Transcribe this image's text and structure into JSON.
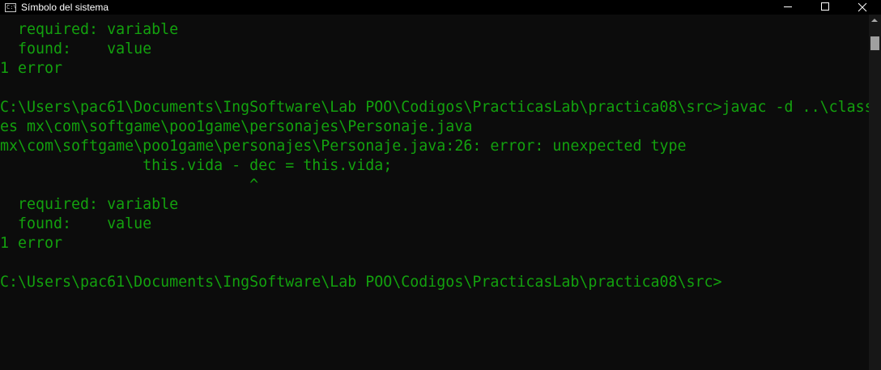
{
  "window": {
    "title": "Símbolo del sistema",
    "icon": "cmd-icon",
    "icon_text": "C:\\"
  },
  "colors": {
    "console_text": "#13a10e",
    "background": "#0c0c0c",
    "titlebar": "#000000"
  },
  "controls": [
    "minimize-icon",
    "maximize-icon",
    "close-icon"
  ],
  "console": {
    "lines": [
      "  required: variable",
      "  found:    value",
      "1 error",
      "",
      "C:\\Users\\pac61\\Documents\\IngSoftware\\Lab POO\\Codigos\\PracticasLab\\practica08\\src>javac -d ..\\class",
      "es mx\\com\\softgame\\poo1game\\personajes\\Personaje.java",
      "mx\\com\\softgame\\poo1game\\personajes\\Personaje.java:26: error: unexpected type",
      "                this.vida - dec = this.vida;",
      "                            ^",
      "  required: variable",
      "  found:    value",
      "1 error",
      "",
      "C:\\Users\\pac61\\Documents\\IngSoftware\\Lab POO\\Codigos\\PracticasLab\\practica08\\src>"
    ]
  }
}
